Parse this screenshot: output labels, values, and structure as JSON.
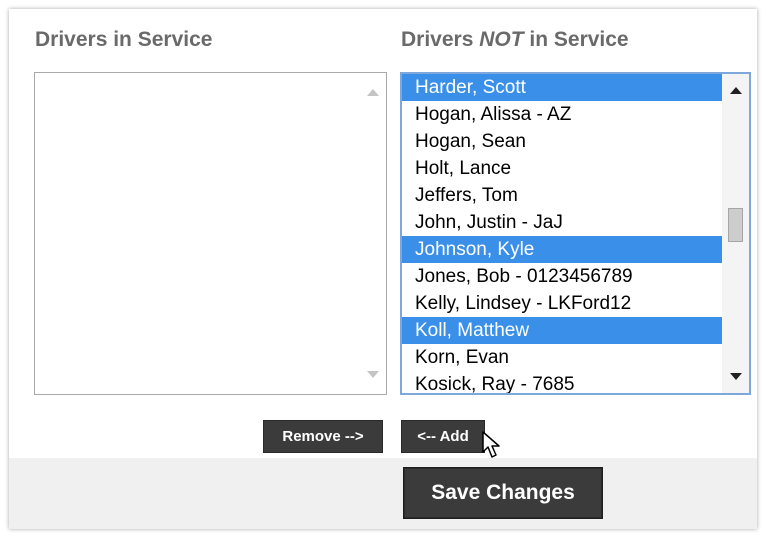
{
  "in_service": {
    "heading": "Drivers in Service",
    "items": []
  },
  "not_in_service": {
    "heading_prefix": "Drivers ",
    "heading_emphasis": "NOT",
    "heading_suffix": " in Service",
    "items": [
      {
        "label": "Harder, Scott",
        "selected": true
      },
      {
        "label": "Hogan, Alissa - AZ",
        "selected": false
      },
      {
        "label": "Hogan, Sean",
        "selected": false
      },
      {
        "label": "Holt, Lance",
        "selected": false
      },
      {
        "label": "Jeffers, Tom",
        "selected": false
      },
      {
        "label": "John, Justin - JaJ",
        "selected": false
      },
      {
        "label": "Johnson, Kyle",
        "selected": true
      },
      {
        "label": "Jones, Bob - 0123456789",
        "selected": false
      },
      {
        "label": "Kelly, Lindsey - LKFord12",
        "selected": false
      },
      {
        "label": "Koll, Matthew",
        "selected": true
      },
      {
        "label": "Korn, Evan",
        "selected": false
      },
      {
        "label": "Kosick, Ray - 7685",
        "selected": false
      }
    ]
  },
  "buttons": {
    "remove_label": "Remove -->",
    "add_label": "<-- Add",
    "save_label": "Save Changes"
  },
  "colors": {
    "selection": "#3a8fe8",
    "button_bg": "#3b3b3b",
    "heading_text": "#6a6a6a",
    "focus_border": "#7ea8dc"
  }
}
